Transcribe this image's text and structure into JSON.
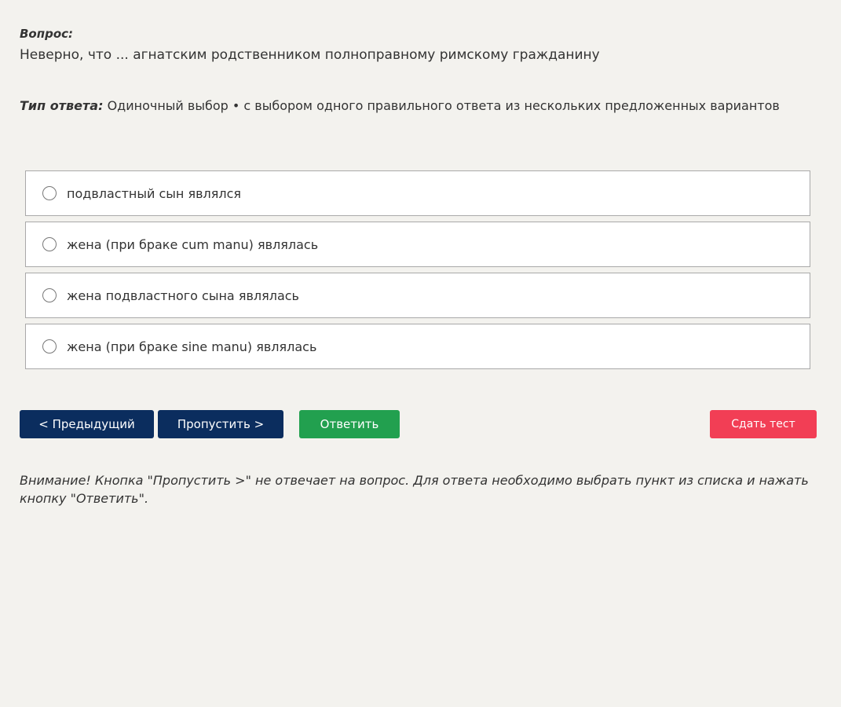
{
  "question": {
    "label": "Вопрос:",
    "text": "Неверно, что ... агнатским родственником полноправному римскому гражданину"
  },
  "answer_type": {
    "label": "Тип ответа:",
    "value": "Одиночный выбор • с выбором одного правильного ответа из нескольких предложенных вариантов"
  },
  "options": [
    {
      "label": "подвластный сын являлся"
    },
    {
      "label": "жена (при браке cum manu) являлась"
    },
    {
      "label": "жена подвластного сына являлась"
    },
    {
      "label": "жена (при браке sine manu) являлась"
    }
  ],
  "buttons": {
    "prev": "< Предыдущий",
    "skip": "Пропустить >",
    "answer": "Ответить",
    "submit": "Сдать тест"
  },
  "note": "Внимание! Кнопка \"Пропустить >\" не отвечает на вопрос. Для ответа необходимо выбрать пункт из списка и нажать кнопку \"Ответить\".",
  "colors": {
    "nav_button": "#0b2d5e",
    "answer_button": "#22a04f",
    "submit_button": "#f23e55",
    "background": "#f3f2ee"
  }
}
